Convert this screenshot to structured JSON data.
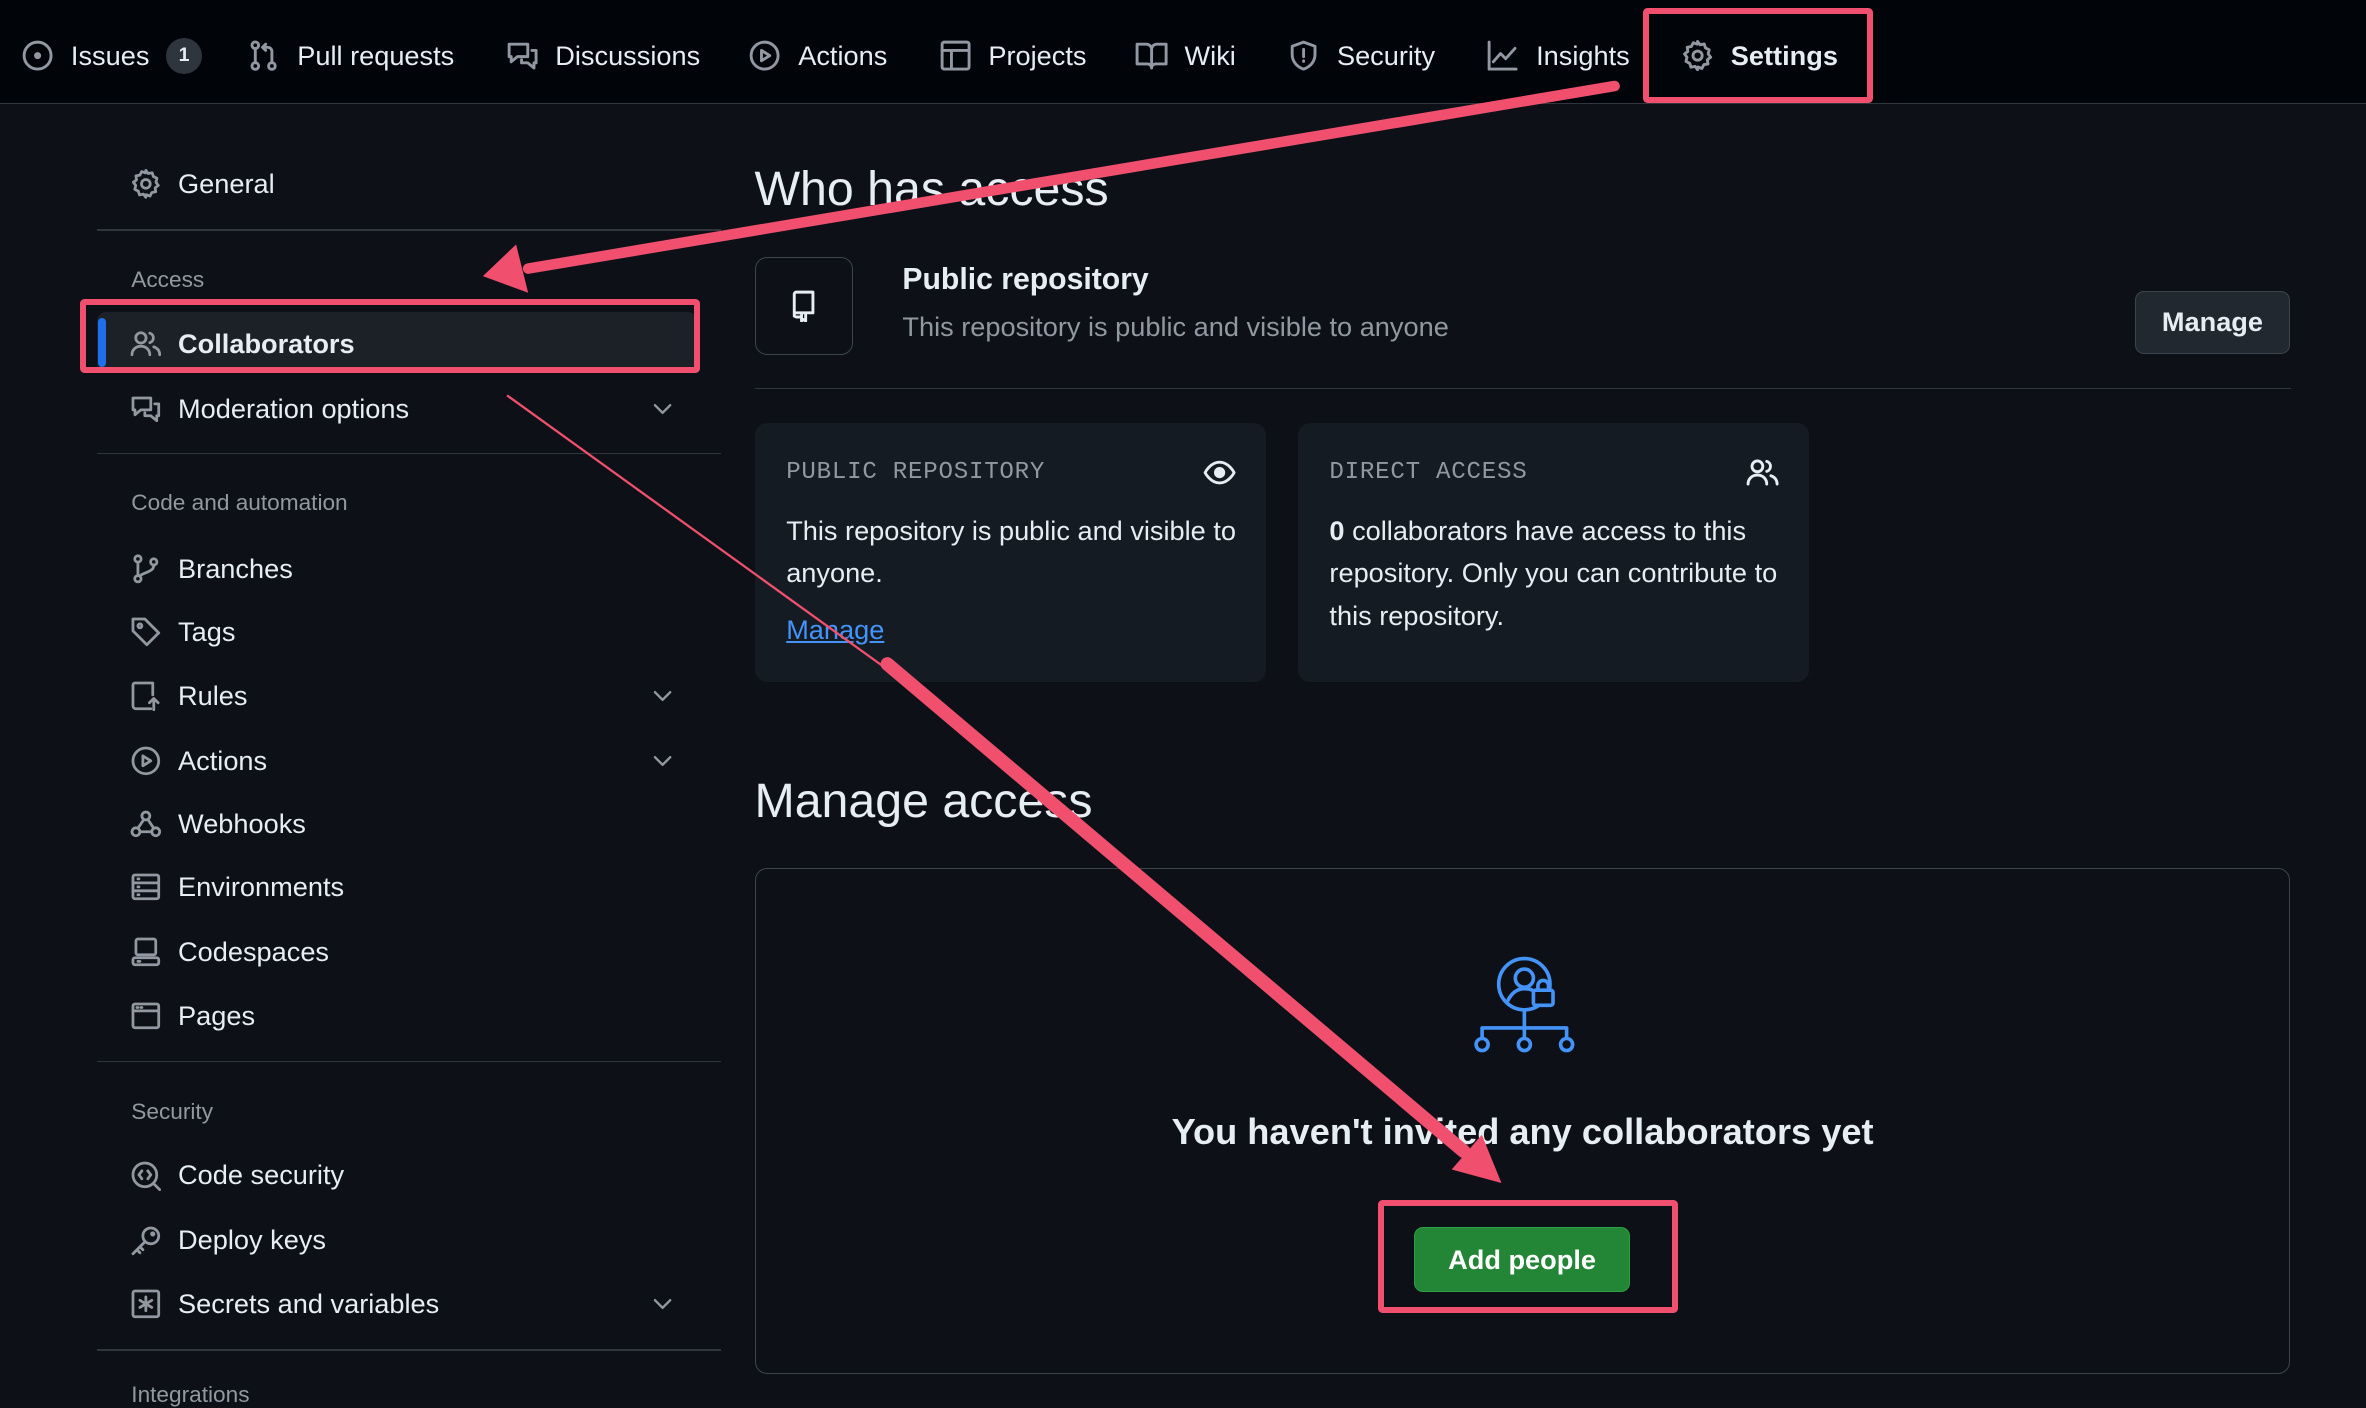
{
  "topnav": {
    "tabs": [
      {
        "label": "Issues",
        "icon": "issue-opened-icon",
        "count": "1"
      },
      {
        "label": "Pull requests",
        "icon": "git-pull-request-icon"
      },
      {
        "label": "Discussions",
        "icon": "comment-discussion-icon"
      },
      {
        "label": "Actions",
        "icon": "play-icon"
      },
      {
        "label": "Projects",
        "icon": "table-icon"
      },
      {
        "label": "Wiki",
        "icon": "book-icon"
      },
      {
        "label": "Security",
        "icon": "shield-icon"
      },
      {
        "label": "Insights",
        "icon": "graph-icon"
      },
      {
        "label": "Settings",
        "icon": "gear-icon",
        "active": true
      }
    ]
  },
  "sidebar": {
    "general": "General",
    "sections": {
      "access": "Access",
      "code": "Code and automation",
      "security": "Security",
      "integrations": "Integrations"
    },
    "items": {
      "collaborators": "Collaborators",
      "moderation": "Moderation options",
      "branches": "Branches",
      "tags": "Tags",
      "rules": "Rules",
      "actions": "Actions",
      "webhooks": "Webhooks",
      "environments": "Environments",
      "codespaces": "Codespaces",
      "pages": "Pages",
      "code_security": "Code security",
      "deploy_keys": "Deploy keys",
      "secrets": "Secrets and variables"
    }
  },
  "main": {
    "who_title": "Who has access",
    "repo_title": "Public repository",
    "repo_desc": "This repository is public and visible to anyone",
    "manage_button": "Manage",
    "public_card": {
      "label": "PUBLIC REPOSITORY",
      "text": "This repository is public and visible to anyone.",
      "link": "Manage"
    },
    "direct_card": {
      "label": "DIRECT ACCESS",
      "count": "0",
      "text": " collaborators have access to this repository. Only you can contribute to this repository."
    },
    "manage_title": "Manage access",
    "empty_title": "You haven't invited any collaborators yet",
    "add_button": "Add people"
  },
  "colors": {
    "background": "#0d1117",
    "accent_blue": "#1f6feb",
    "link_blue": "#4493f8",
    "primary_green": "#238636",
    "annotation_red": "#f0506e"
  }
}
